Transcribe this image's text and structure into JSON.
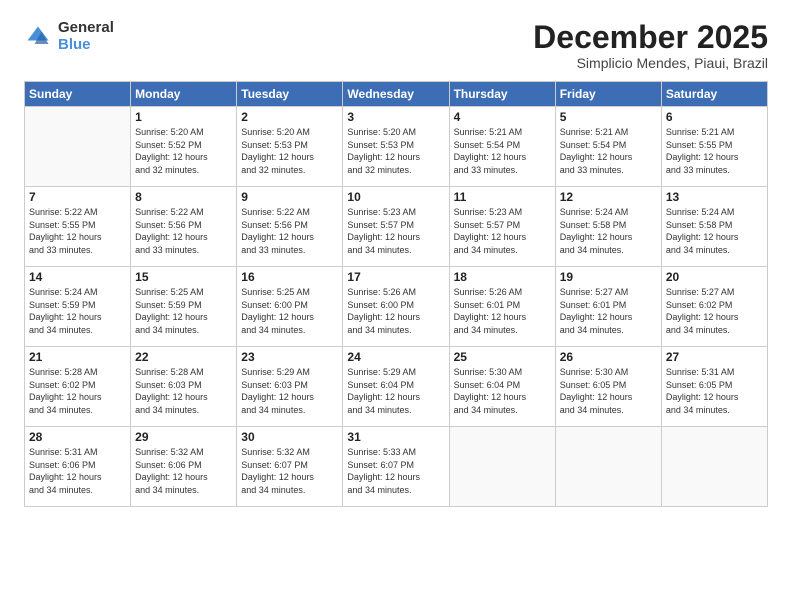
{
  "logo": {
    "general": "General",
    "blue": "Blue"
  },
  "title": "December 2025",
  "location": "Simplicio Mendes, Piaui, Brazil",
  "days_header": [
    "Sunday",
    "Monday",
    "Tuesday",
    "Wednesday",
    "Thursday",
    "Friday",
    "Saturday"
  ],
  "weeks": [
    [
      {
        "num": "",
        "info": ""
      },
      {
        "num": "1",
        "info": "Sunrise: 5:20 AM\nSunset: 5:52 PM\nDaylight: 12 hours\nand 32 minutes."
      },
      {
        "num": "2",
        "info": "Sunrise: 5:20 AM\nSunset: 5:53 PM\nDaylight: 12 hours\nand 32 minutes."
      },
      {
        "num": "3",
        "info": "Sunrise: 5:20 AM\nSunset: 5:53 PM\nDaylight: 12 hours\nand 32 minutes."
      },
      {
        "num": "4",
        "info": "Sunrise: 5:21 AM\nSunset: 5:54 PM\nDaylight: 12 hours\nand 33 minutes."
      },
      {
        "num": "5",
        "info": "Sunrise: 5:21 AM\nSunset: 5:54 PM\nDaylight: 12 hours\nand 33 minutes."
      },
      {
        "num": "6",
        "info": "Sunrise: 5:21 AM\nSunset: 5:55 PM\nDaylight: 12 hours\nand 33 minutes."
      }
    ],
    [
      {
        "num": "7",
        "info": "Sunrise: 5:22 AM\nSunset: 5:55 PM\nDaylight: 12 hours\nand 33 minutes."
      },
      {
        "num": "8",
        "info": "Sunrise: 5:22 AM\nSunset: 5:56 PM\nDaylight: 12 hours\nand 33 minutes."
      },
      {
        "num": "9",
        "info": "Sunrise: 5:22 AM\nSunset: 5:56 PM\nDaylight: 12 hours\nand 33 minutes."
      },
      {
        "num": "10",
        "info": "Sunrise: 5:23 AM\nSunset: 5:57 PM\nDaylight: 12 hours\nand 34 minutes."
      },
      {
        "num": "11",
        "info": "Sunrise: 5:23 AM\nSunset: 5:57 PM\nDaylight: 12 hours\nand 34 minutes."
      },
      {
        "num": "12",
        "info": "Sunrise: 5:24 AM\nSunset: 5:58 PM\nDaylight: 12 hours\nand 34 minutes."
      },
      {
        "num": "13",
        "info": "Sunrise: 5:24 AM\nSunset: 5:58 PM\nDaylight: 12 hours\nand 34 minutes."
      }
    ],
    [
      {
        "num": "14",
        "info": "Sunrise: 5:24 AM\nSunset: 5:59 PM\nDaylight: 12 hours\nand 34 minutes."
      },
      {
        "num": "15",
        "info": "Sunrise: 5:25 AM\nSunset: 5:59 PM\nDaylight: 12 hours\nand 34 minutes."
      },
      {
        "num": "16",
        "info": "Sunrise: 5:25 AM\nSunset: 6:00 PM\nDaylight: 12 hours\nand 34 minutes."
      },
      {
        "num": "17",
        "info": "Sunrise: 5:26 AM\nSunset: 6:00 PM\nDaylight: 12 hours\nand 34 minutes."
      },
      {
        "num": "18",
        "info": "Sunrise: 5:26 AM\nSunset: 6:01 PM\nDaylight: 12 hours\nand 34 minutes."
      },
      {
        "num": "19",
        "info": "Sunrise: 5:27 AM\nSunset: 6:01 PM\nDaylight: 12 hours\nand 34 minutes."
      },
      {
        "num": "20",
        "info": "Sunrise: 5:27 AM\nSunset: 6:02 PM\nDaylight: 12 hours\nand 34 minutes."
      }
    ],
    [
      {
        "num": "21",
        "info": "Sunrise: 5:28 AM\nSunset: 6:02 PM\nDaylight: 12 hours\nand 34 minutes."
      },
      {
        "num": "22",
        "info": "Sunrise: 5:28 AM\nSunset: 6:03 PM\nDaylight: 12 hours\nand 34 minutes."
      },
      {
        "num": "23",
        "info": "Sunrise: 5:29 AM\nSunset: 6:03 PM\nDaylight: 12 hours\nand 34 minutes."
      },
      {
        "num": "24",
        "info": "Sunrise: 5:29 AM\nSunset: 6:04 PM\nDaylight: 12 hours\nand 34 minutes."
      },
      {
        "num": "25",
        "info": "Sunrise: 5:30 AM\nSunset: 6:04 PM\nDaylight: 12 hours\nand 34 minutes."
      },
      {
        "num": "26",
        "info": "Sunrise: 5:30 AM\nSunset: 6:05 PM\nDaylight: 12 hours\nand 34 minutes."
      },
      {
        "num": "27",
        "info": "Sunrise: 5:31 AM\nSunset: 6:05 PM\nDaylight: 12 hours\nand 34 minutes."
      }
    ],
    [
      {
        "num": "28",
        "info": "Sunrise: 5:31 AM\nSunset: 6:06 PM\nDaylight: 12 hours\nand 34 minutes."
      },
      {
        "num": "29",
        "info": "Sunrise: 5:32 AM\nSunset: 6:06 PM\nDaylight: 12 hours\nand 34 minutes."
      },
      {
        "num": "30",
        "info": "Sunrise: 5:32 AM\nSunset: 6:07 PM\nDaylight: 12 hours\nand 34 minutes."
      },
      {
        "num": "31",
        "info": "Sunrise: 5:33 AM\nSunset: 6:07 PM\nDaylight: 12 hours\nand 34 minutes."
      },
      {
        "num": "",
        "info": ""
      },
      {
        "num": "",
        "info": ""
      },
      {
        "num": "",
        "info": ""
      }
    ]
  ]
}
